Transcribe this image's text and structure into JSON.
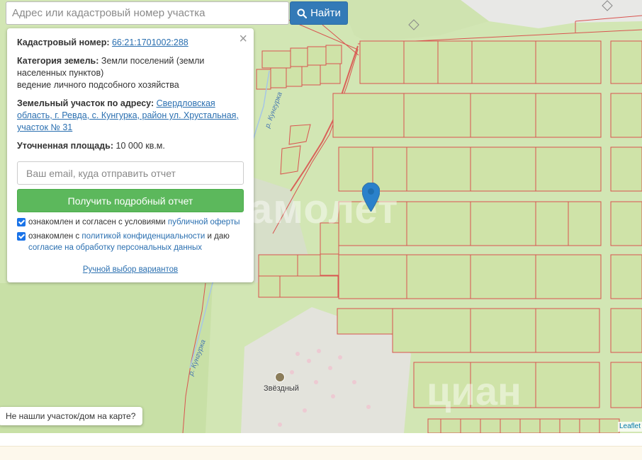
{
  "search": {
    "placeholder": "Адрес или кадастровый номер участка",
    "button_label": "Найти"
  },
  "panel": {
    "cadastral_label": "Кадастровый номер:",
    "cadastral_number": "66:21:1701002:288",
    "category_label": "Категория земель:",
    "category_value": "Земли поселений (земли населенных пунктов)",
    "usage": "ведение личного подсобного хозяйства",
    "address_label": "Земельный участок по адресу:",
    "address_value": "Свердловская область, г. Ревда, с. Кунгурка, район ул. Хрустальная, участок № 31",
    "area_label": "Уточненная площадь:",
    "area_value": "10 000 кв.м.",
    "email_placeholder": "Ваш email, куда отправить отчет",
    "report_button": "Получить подробный отчет",
    "check1_text": "ознакомлен и согласен с условиями",
    "check1_link": "публичной оферты",
    "check2_text": "ознакомлен с",
    "check2_link": "политикой конфиденциальности",
    "check2_text2": "и даю",
    "check2_link2": "согласие на обработку персональных данных",
    "manual_link": "Ручной выбор вариантов",
    "close_symbol": "×"
  },
  "map": {
    "village_name": "Звёздный",
    "river_label_1": "р. Кунгурка",
    "river_label_2": "р. Кунгурка",
    "watermark_1": "самолет",
    "watermark_2": "циан",
    "attribution": "Leaflet",
    "colors": {
      "background": "#d2e6b4",
      "parcel_fill": "#cfe3a8",
      "parcel_stroke": "#d9534f",
      "marker": "#2a81cb"
    }
  },
  "bottom_prompt": "Не нашли участок/дом на карте?"
}
